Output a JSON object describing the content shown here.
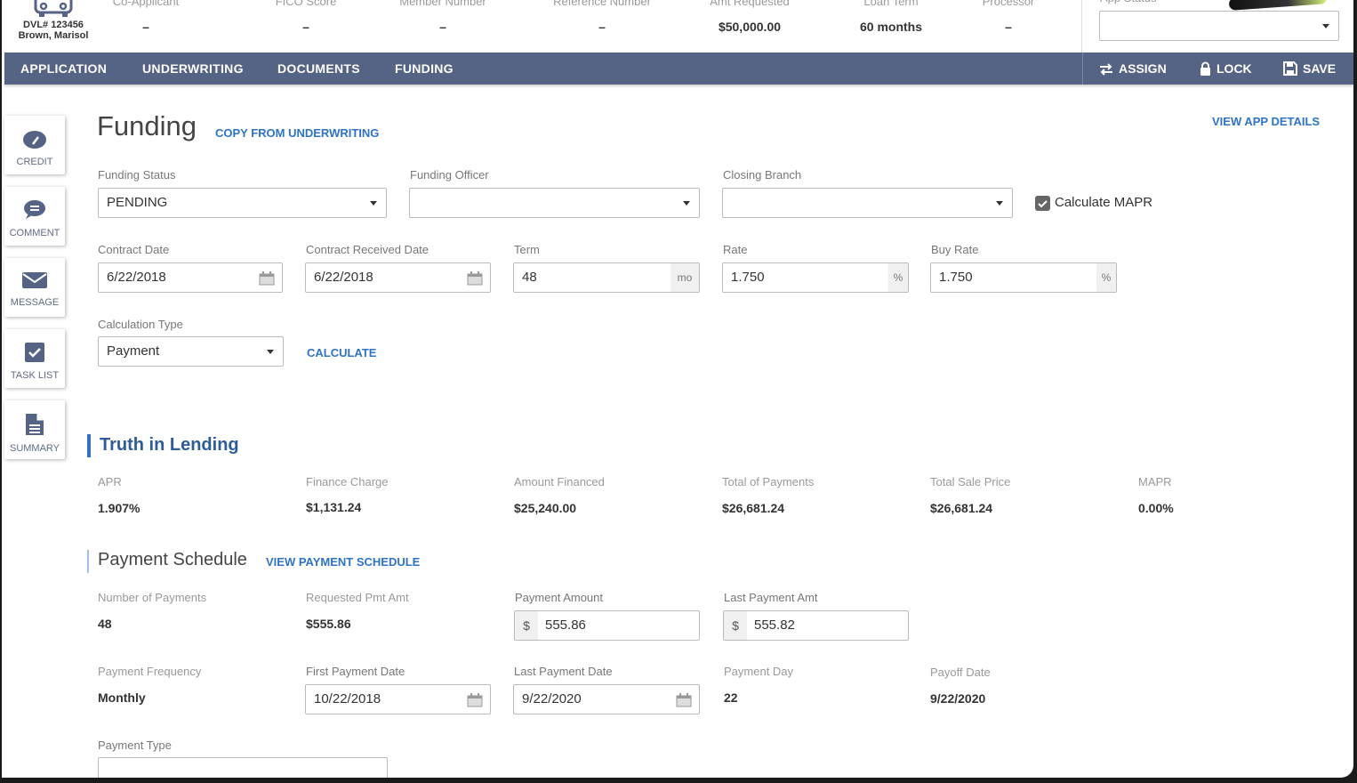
{
  "header": {
    "dvl": "DVL# 123456",
    "applicant": "Brown, Marisol",
    "fields": [
      {
        "label": "Co-Applicant",
        "value": "–"
      },
      {
        "label": "FICO Score",
        "value": "–"
      },
      {
        "label": "Member Number",
        "value": "–"
      },
      {
        "label": "Reference Number",
        "value": "–"
      },
      {
        "label": "Amt Requested",
        "value": "$50,000.00"
      },
      {
        "label": "Loan Term",
        "value": "60 months"
      },
      {
        "label": "Processor",
        "value": "–"
      }
    ],
    "app_status_label": "App Status",
    "app_status_value": ""
  },
  "nav": {
    "tabs": [
      "APPLICATION",
      "UNDERWRITING",
      "DOCUMENTS",
      "FUNDING"
    ],
    "actions": {
      "assign": "ASSIGN",
      "lock": "LOCK",
      "save": "SAVE"
    }
  },
  "rail": [
    "CREDIT",
    "COMMENT",
    "MESSAGE",
    "TASK LIST",
    "SUMMARY"
  ],
  "page": {
    "title": "Funding",
    "copy_link": "COPY FROM UNDERWRITING",
    "view_app_details": "VIEW APP DETAILS"
  },
  "form": {
    "funding_status": {
      "label": "Funding Status",
      "value": "PENDING"
    },
    "funding_officer": {
      "label": "Funding Officer",
      "value": ""
    },
    "closing_branch": {
      "label": "Closing Branch",
      "value": ""
    },
    "calculate_mapr": {
      "label": "Calculate MAPR",
      "checked": true
    },
    "contract_date": {
      "label": "Contract Date",
      "value": "6/22/2018"
    },
    "contract_received_date": {
      "label": "Contract Received Date",
      "value": "6/22/2018"
    },
    "term": {
      "label": "Term",
      "value": "48",
      "suffix": "mo"
    },
    "rate": {
      "label": "Rate",
      "value": "1.750",
      "suffix": "%"
    },
    "buy_rate": {
      "label": "Buy Rate",
      "value": "1.750",
      "suffix": "%"
    },
    "calculation_type": {
      "label": "Calculation Type",
      "value": "Payment"
    },
    "calculate_button": "CALCULATE"
  },
  "til": {
    "title": "Truth in Lending",
    "items": [
      {
        "label": "APR",
        "value": "1.907%"
      },
      {
        "label": "Finance Charge",
        "value": "$1,131.24"
      },
      {
        "label": "Amount Financed",
        "value": "$25,240.00"
      },
      {
        "label": "Total of Payments",
        "value": "$26,681.24"
      },
      {
        "label": "Total Sale Price",
        "value": "$26,681.24"
      },
      {
        "label": "MAPR",
        "value": "0.00%"
      }
    ]
  },
  "schedule": {
    "title": "Payment Schedule",
    "view_link": "VIEW PAYMENT SCHEDULE",
    "number_of_payments": {
      "label": "Number of Payments",
      "value": "48"
    },
    "requested_pmt_amt": {
      "label": "Requested Pmt Amt",
      "value": "$555.86"
    },
    "payment_amount": {
      "label": "Payment Amount",
      "prefix": "$",
      "value": "555.86"
    },
    "last_payment_amt": {
      "label": "Last Payment Amt",
      "prefix": "$",
      "value": "555.82"
    },
    "payment_frequency": {
      "label": "Payment Frequency",
      "value": "Monthly"
    },
    "first_payment_date": {
      "label": "First Payment Date",
      "value": "10/22/2018"
    },
    "last_payment_date": {
      "label": "Last Payment Date",
      "value": "9/22/2020"
    },
    "payment_day": {
      "label": "Payment Day",
      "value": "22"
    },
    "payoff_date": {
      "label": "Payoff Date",
      "value": "9/22/2020"
    },
    "payment_type": {
      "label": "Payment Type",
      "value": ""
    }
  },
  "colors": {
    "nav_bg": "#556384",
    "link": "#2f73c4",
    "rail_icon": "#556384"
  }
}
